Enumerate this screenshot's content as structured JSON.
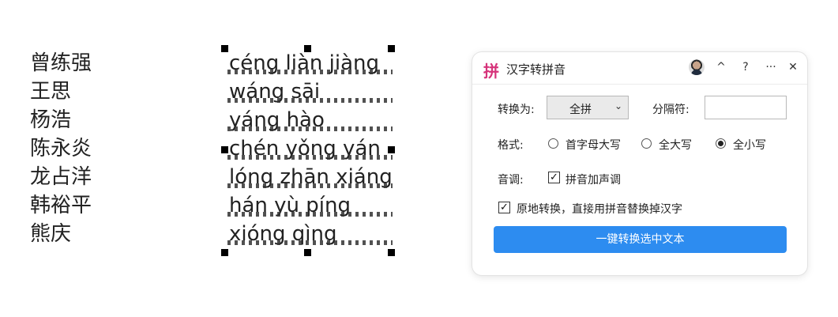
{
  "document": {
    "names": [
      "曾练强",
      "王思",
      "杨浩",
      "陈永炎",
      "龙占洋",
      "韩裕平",
      "熊庆"
    ],
    "pinyin": [
      "céng liàn jiàng",
      "wáng sāi",
      "yáng hào",
      "chén yǒng yán",
      "lóng zhān xiáng",
      "hán yù píng",
      "xióng qìng"
    ]
  },
  "panel": {
    "logo": "拼",
    "title": "汉字转拼音",
    "buttons": {
      "collapse": "^",
      "help": "?",
      "more": "···",
      "close": "✕"
    },
    "convert_label": "转换为:",
    "convert_value": "全拼",
    "separator_label": "分隔符:",
    "separator_value": "",
    "format_label": "格式:",
    "format_options": [
      "首字母大写",
      "全大写",
      "全小写"
    ],
    "format_selected": "全小写",
    "tone_label": "音调:",
    "tone_option": "拼音加声调",
    "tone_checked": true,
    "inplace_option": "原地转换，直接用拼音替换掉汉字",
    "inplace_checked": true,
    "action_button": "一键转换选中文本"
  },
  "colors": {
    "accent": "#2d8cf0",
    "logo": "#d6337a"
  },
  "icons": [
    "chevron-down-icon",
    "collapse-icon",
    "help-icon",
    "more-icon",
    "close-icon",
    "check-icon"
  ]
}
